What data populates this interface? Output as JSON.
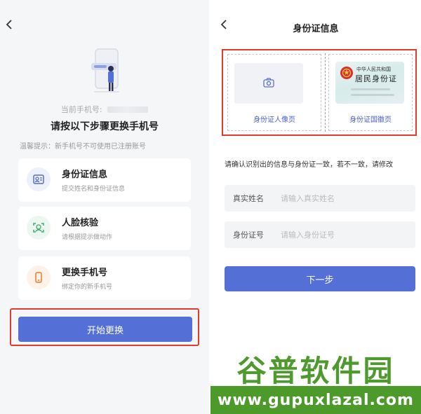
{
  "left": {
    "back_icon": "chevron-left",
    "current_phone_label": "当前手机号:",
    "steps_title": "请按以下步骤更换手机号",
    "tip": "温馨提示：新手机号不可使用已注册账号",
    "steps": [
      {
        "title": "身份证信息",
        "desc": "提交姓名和身份证信息",
        "icon": "id-card-icon",
        "icon_color": "#5470d6",
        "icon_bg": "#eef1fb"
      },
      {
        "title": "人脸核验",
        "desc": "请根据提示做动作",
        "icon": "face-scan-icon",
        "icon_color": "#3fae6a",
        "icon_bg": "#edf7f1"
      },
      {
        "title": "更换手机号",
        "desc": "绑定你的新手机号",
        "icon": "phone-icon",
        "icon_color": "#f07b2f",
        "icon_bg": "#fdf1e8"
      }
    ],
    "start_button": "开始更换"
  },
  "right": {
    "back_icon": "chevron-left",
    "title": "身份证信息",
    "portrait_caption": "身份证人像页",
    "emblem_caption": "身份证国徽页",
    "id_card_line1": "中华人民共和国",
    "id_card_line2": "居民身份证",
    "confirm_text": "请确认识别出的信息与身份证一致，若不一致，请修改",
    "fields": [
      {
        "label": "真实姓名",
        "placeholder": "请输入真实姓名"
      },
      {
        "label": "身份证号",
        "placeholder": "请输入身份证号"
      }
    ],
    "next_button": "下一步"
  },
  "watermark": {
    "text": "谷普软件园",
    "url": "www.gupuxlazal.com"
  },
  "colors": {
    "primary": "#5470d6",
    "highlight": "#e23a2e",
    "watermark_green": "#4c9b2a"
  }
}
